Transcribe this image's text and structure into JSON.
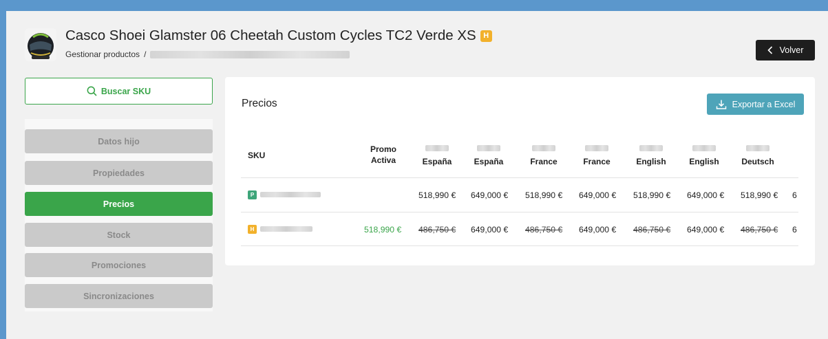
{
  "header": {
    "title": "Casco Shoei Glamster 06 Cheetah Custom Cycles TC2 Verde XS",
    "title_badge": "H",
    "breadcrumb_root": "Gestionar productos",
    "breadcrumb_sep": "/",
    "back_label": "Volver"
  },
  "sidebar": {
    "search_label": "Buscar SKU",
    "items": [
      {
        "label": "Datos hijo"
      },
      {
        "label": "Propiedades"
      },
      {
        "label": "Precios"
      },
      {
        "label": "Stock"
      },
      {
        "label": "Promociones"
      },
      {
        "label": "Sincronizaciones"
      }
    ],
    "active_index": 2
  },
  "main": {
    "title": "Precios",
    "export_label": "Exportar a Excel",
    "columns": {
      "sku": "SKU",
      "promo_line1": "Promo",
      "promo_line2": "Activa",
      "c1": "España",
      "c2": "España",
      "c3": "France",
      "c4": "France",
      "c5": "English",
      "c6": "English",
      "c7": "Deutsch"
    },
    "rows": [
      {
        "badge": "P",
        "promo": "",
        "c1": "518,990 €",
        "c2": "649,000 €",
        "c3": "518,990 €",
        "c4": "649,000 €",
        "c5": "518,990 €",
        "c6": "649,000 €",
        "c7": "518,990 €",
        "c8": "6"
      },
      {
        "badge": "H",
        "promo": "518,990 €",
        "c1": "486,750 €",
        "c2": "649,000 €",
        "c3": "486,750 €",
        "c4": "649,000 €",
        "c5": "486,750 €",
        "c6": "649,000 €",
        "c7": "486,750 €",
        "c8": "6"
      }
    ]
  },
  "colors": {
    "accent_green": "#3aa54a",
    "export_teal": "#4ea4b9",
    "badge_orange": "#f2b12b",
    "badge_p_green": "#3ea57a",
    "frame_blue": "#5b97cc"
  }
}
